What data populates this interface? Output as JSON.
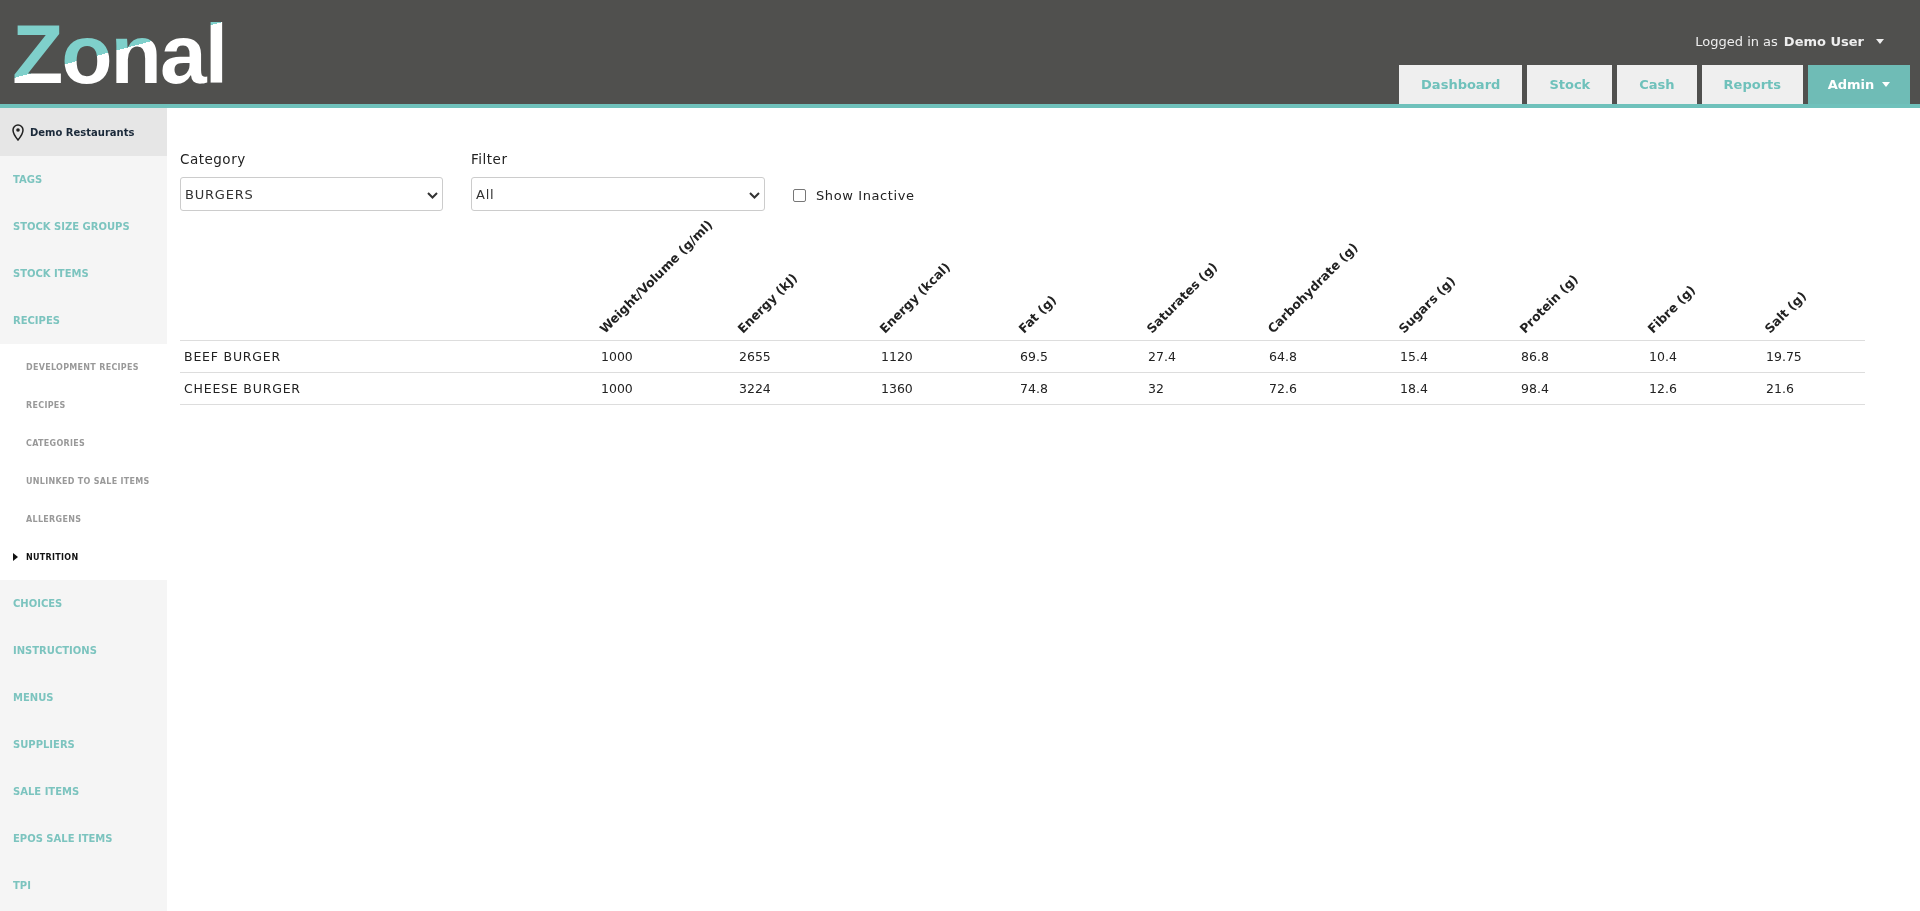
{
  "header": {
    "logo": "Zonal",
    "user_prefix": "Logged in as",
    "user_name": "Demo User",
    "nav": [
      {
        "label": "Dashboard",
        "selected": false,
        "dropdown": false
      },
      {
        "label": "Stock",
        "selected": false,
        "dropdown": false
      },
      {
        "label": "Cash",
        "selected": false,
        "dropdown": false
      },
      {
        "label": "Reports",
        "selected": false,
        "dropdown": false
      },
      {
        "label": "Admin",
        "selected": true,
        "dropdown": true
      }
    ]
  },
  "sidebar": {
    "location": "Demo Restaurants",
    "items": [
      {
        "label": "TAGS",
        "selected": false
      },
      {
        "label": "STOCK SIZE GROUPS",
        "selected": false
      },
      {
        "label": "STOCK ITEMS",
        "selected": false
      },
      {
        "label": "RECIPES",
        "selected": false,
        "children": [
          {
            "label": "DEVELOPMENT RECIPES",
            "selected": false
          },
          {
            "label": "RECIPES",
            "selected": false
          },
          {
            "label": "CATEGORIES",
            "selected": false
          },
          {
            "label": "UNLINKED TO SALE ITEMS",
            "selected": false
          },
          {
            "label": "ALLERGENS",
            "selected": false
          },
          {
            "label": "NUTRITION",
            "selected": true
          }
        ]
      },
      {
        "label": "CHOICES",
        "selected": false
      },
      {
        "label": "INSTRUCTIONS",
        "selected": false
      },
      {
        "label": "MENUS",
        "selected": false
      },
      {
        "label": "SUPPLIERS",
        "selected": false
      },
      {
        "label": "SALE ITEMS",
        "selected": false
      },
      {
        "label": "EPOS SALE ITEMS",
        "selected": false
      },
      {
        "label": "TPI",
        "selected": false
      }
    ]
  },
  "filters": {
    "category": {
      "label": "Category",
      "value": "BURGERS"
    },
    "filter": {
      "label": "Filter",
      "value": "All"
    },
    "show_inactive": {
      "label": "Show Inactive",
      "checked": false
    }
  },
  "table": {
    "columns": [
      "Weight/Volume (g/ml)",
      "Energy (kJ)",
      "Energy (kcal)",
      "Fat (g)",
      "Saturates (g)",
      "Carbohydrate (g)",
      "Sugars (g)",
      "Protein (g)",
      "Fibre (g)",
      "Salt (g)"
    ],
    "rows": [
      {
        "name": "BEEF BURGER",
        "values": [
          "1000",
          "2655",
          "1120",
          "69.5",
          "27.4",
          "64.8",
          "15.4",
          "86.8",
          "10.4",
          "19.75"
        ]
      },
      {
        "name": "CHEESE BURGER",
        "values": [
          "1000",
          "3224",
          "1360",
          "74.8",
          "32",
          "72.6",
          "18.4",
          "98.4",
          "12.6",
          "21.6"
        ]
      }
    ]
  }
}
